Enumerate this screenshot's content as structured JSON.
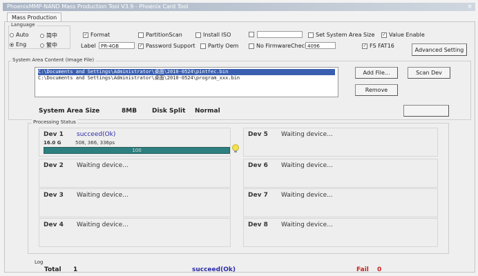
{
  "window": {
    "title": "PhoenixMMP-NAND Mass Production Tool V3.9 - Phoenix Card Tool",
    "close_glyph": "×",
    "tab": "Mass Production"
  },
  "language": {
    "title": "Language",
    "options": [
      {
        "label": "Auto",
        "selected": false
      },
      {
        "label": "简中",
        "selected": false
      },
      {
        "label": "Eng",
        "selected": true
      },
      {
        "label": "繁中",
        "selected": false
      }
    ]
  },
  "options": {
    "format": {
      "label": "Format",
      "checked": true
    },
    "partition_scan": {
      "label": "PartitionScan",
      "checked": false
    },
    "install_iso": {
      "label": "Install ISO",
      "checked": false
    },
    "unnamed_check": {
      "label": "",
      "checked": false
    },
    "set_system_area_size": {
      "label": "Set System Area Size",
      "checked": false
    },
    "value_enable": {
      "label": "Value Enable",
      "checked": true
    },
    "label_title": "Label",
    "label_value": "PR-4GB",
    "password_support": {
      "label": "Password Support",
      "checked": true
    },
    "partly_oem": {
      "label": "Partly Oem",
      "checked": false
    },
    "no_firmware_check": {
      "label": "No FirmwareCheck",
      "checked": false
    },
    "no_firmware_value": "4096",
    "fs_fat16": {
      "label": "FS FAT16",
      "checked": true
    },
    "advanced_setting": "Advanced Setting"
  },
  "system_area": {
    "title": "System Area Content (Image File)",
    "files": [
      "C:\\Documents and Settings\\Administrator\\桌面\\2010-0524\\pintfec.bin",
      "C:\\Documents and Settings\\Administrator\\桌面\\2010-0524\\program_xxx.bin"
    ],
    "add_button": "Add File...",
    "remove_button": "Remove",
    "scan_button": "Scan Dev",
    "size_label": "System Area Size",
    "size_value": "8MB",
    "disk_split_label": "Disk Split",
    "disk_split_value": "Normal",
    "extra_button": ""
  },
  "progress": {
    "title": "Processing Status",
    "devices": [
      {
        "label": "Dev 1",
        "status": "succeed(Ok)",
        "sub_label": "16.0 G",
        "sub_value": "508, 366, 336ps",
        "bar_text": "100",
        "progress": 1.0
      },
      {
        "label": "Dev 2",
        "status": "Waiting device..."
      },
      {
        "label": "Dev 3",
        "status": "Waiting device..."
      },
      {
        "label": "Dev 4",
        "status": "Waiting device..."
      },
      {
        "label": "Dev 5",
        "status": "Waiting device..."
      },
      {
        "label": "Dev 6",
        "status": "Waiting device..."
      },
      {
        "label": "Dev 7",
        "status": "Waiting device..."
      },
      {
        "label": "Dev 8",
        "status": "Waiting device..."
      }
    ]
  },
  "footer": {
    "title": "Log",
    "total_label": "Total",
    "total_value": "1",
    "succeed_text": "succeed(Ok)",
    "fail_label": "Fail",
    "fail_value": "0"
  },
  "colors": {
    "bar": "#2e7f7f",
    "ok_text": "#2a2aa6",
    "fail_text": "#cc2222"
  }
}
